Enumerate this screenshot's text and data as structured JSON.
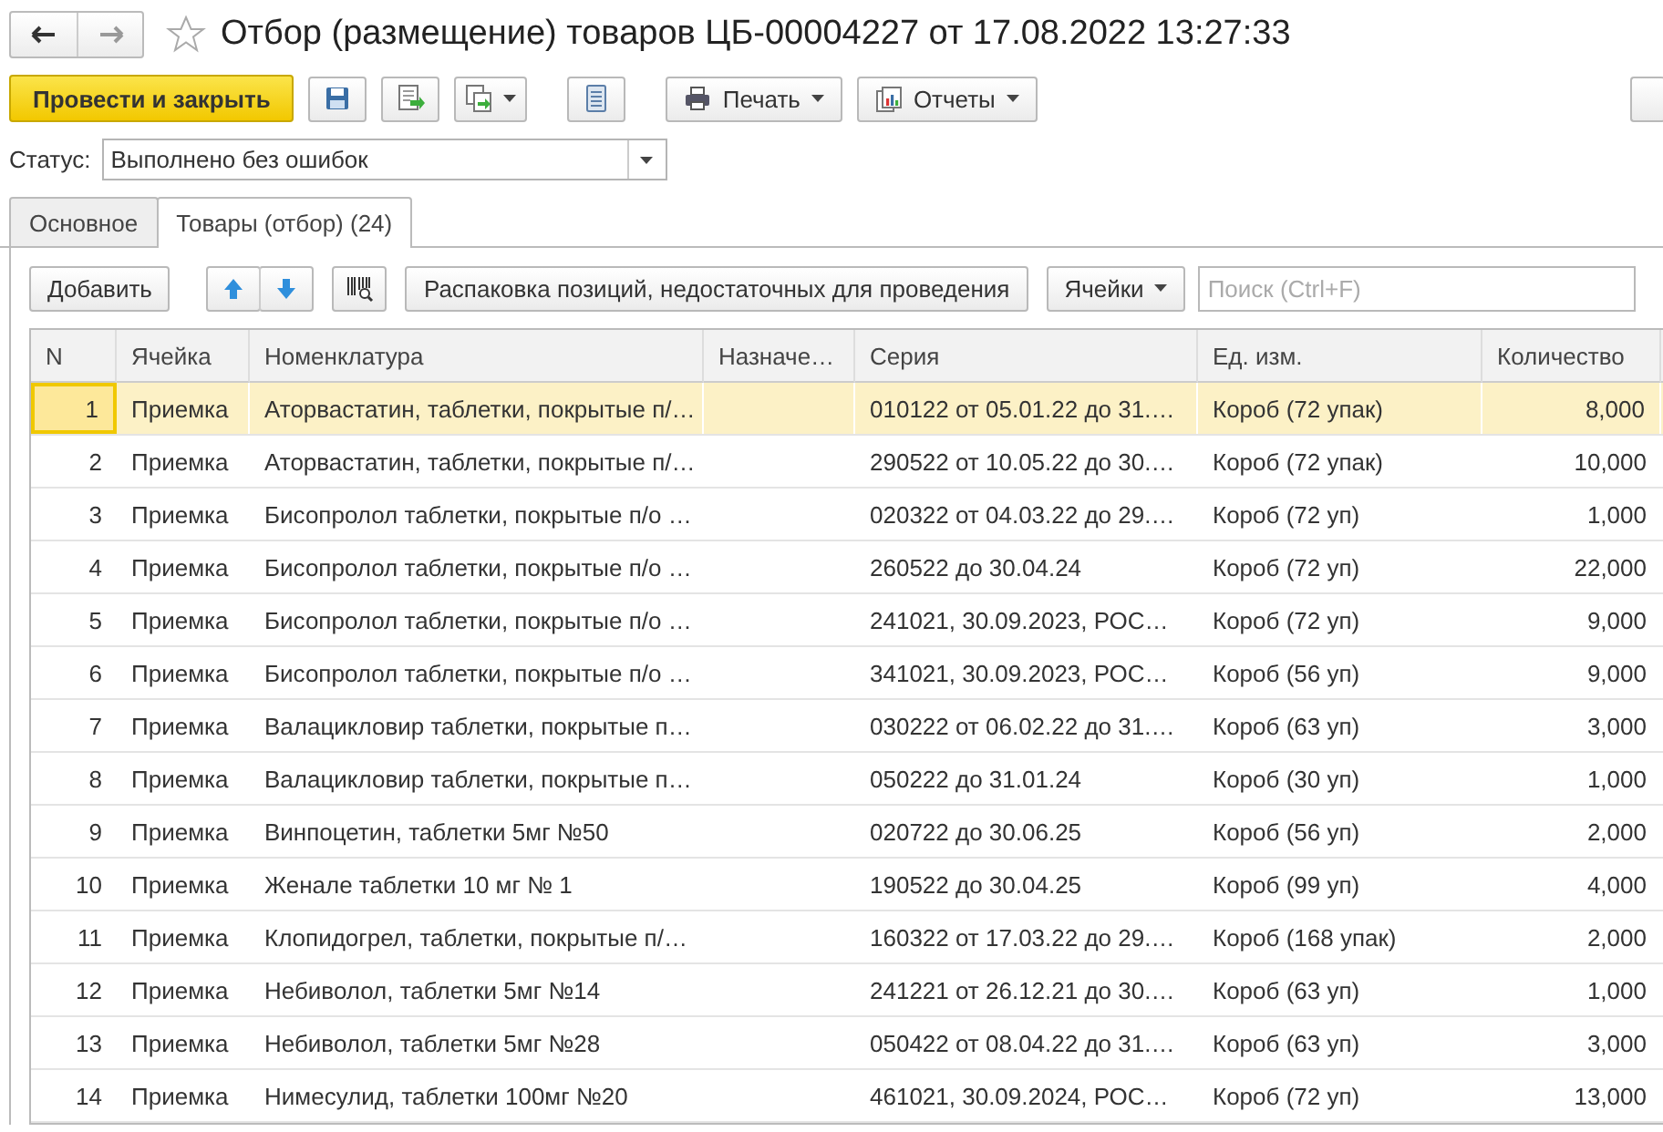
{
  "window": {
    "title": "Отбор (размещение) товаров ЦБ-00004227 от 17.08.2022 13:27:33",
    "favorite": false
  },
  "toolbar": {
    "primary": "Провести и закрыть",
    "print": "Печать",
    "reports": "Отчеты"
  },
  "status": {
    "label": "Статус:",
    "value": "Выполнено без ошибок"
  },
  "tabs": [
    {
      "label": "Основное",
      "selected": false
    },
    {
      "label": "Товары (отбор) (24)",
      "selected": true
    }
  ],
  "table_toolbar": {
    "add": "Добавить",
    "unpack": "Распаковка позиций, недостаточных для проведения",
    "cells": "Ячейки",
    "search_placeholder": "Поиск (Ctrl+F)"
  },
  "table": {
    "columns": [
      "N",
      "Ячейка",
      "Номенклатура",
      "Назначе…",
      "Серия",
      "Ед. изм.",
      "Количество"
    ],
    "rows": [
      {
        "n": "1",
        "cell": "Приемка",
        "item": "Аторвастатин, таблетки, покрытые п/…",
        "series": "010122 от 05.01.22 до 31.…",
        "unit": "Короб (72 упак)",
        "qty": "8,000",
        "selected": true
      },
      {
        "n": "2",
        "cell": "Приемка",
        "item": "Аторвастатин, таблетки, покрытые п/…",
        "series": "290522 от 10.05.22 до 30.…",
        "unit": "Короб (72 упак)",
        "qty": "10,000",
        "selected": false
      },
      {
        "n": "3",
        "cell": "Приемка",
        "item": "Бисопролол таблетки, покрытые п/о …",
        "series": "020322 от 04.03.22 до 29.…",
        "unit": "Короб (72 уп)",
        "qty": "1,000",
        "selected": false
      },
      {
        "n": "4",
        "cell": "Приемка",
        "item": "Бисопролол таблетки, покрытые п/о …",
        "series": "260522 до 30.04.24",
        "unit": "Короб (72 уп)",
        "qty": "22,000",
        "selected": false
      },
      {
        "n": "5",
        "cell": "Приемка",
        "item": "Бисопролол таблетки, покрытые п/о …",
        "series": "241021, 30.09.2023, РОС…",
        "unit": "Короб (72 уп)",
        "qty": "9,000",
        "selected": false
      },
      {
        "n": "6",
        "cell": "Приемка",
        "item": "Бисопролол таблетки, покрытые п/о …",
        "series": "341021, 30.09.2023, РОС…",
        "unit": "Короб (56 уп)",
        "qty": "9,000",
        "selected": false
      },
      {
        "n": "7",
        "cell": "Приемка",
        "item": "Валацикловир таблетки, покрытые п…",
        "series": "030222 от 06.02.22 до 31.…",
        "unit": "Короб (63 уп)",
        "qty": "3,000",
        "selected": false
      },
      {
        "n": "8",
        "cell": "Приемка",
        "item": "Валацикловир таблетки, покрытые п…",
        "series": "050222 до 31.01.24",
        "unit": "Короб (30 уп)",
        "qty": "1,000",
        "selected": false
      },
      {
        "n": "9",
        "cell": "Приемка",
        "item": "Винпоцетин, таблетки 5мг №50",
        "series": "020722 до 30.06.25",
        "unit": "Короб (56 уп)",
        "qty": "2,000",
        "selected": false
      },
      {
        "n": "10",
        "cell": "Приемка",
        "item": "Женале таблетки 10 мг № 1",
        "series": "190522 до 30.04.25",
        "unit": "Короб (99 уп)",
        "qty": "4,000",
        "selected": false
      },
      {
        "n": "11",
        "cell": "Приемка",
        "item": "Клопидогрел, таблетки, покрытые п/…",
        "series": "160322 от 17.03.22 до 29.…",
        "unit": "Короб (168 упак)",
        "qty": "2,000",
        "selected": false
      },
      {
        "n": "12",
        "cell": "Приемка",
        "item": "Небиволол, таблетки 5мг №14",
        "series": "241221 от 26.12.21 до 30.…",
        "unit": "Короб (63 уп)",
        "qty": "1,000",
        "selected": false
      },
      {
        "n": "13",
        "cell": "Приемка",
        "item": "Небиволол, таблетки 5мг №28",
        "series": "050422 от 08.04.22 до 31.…",
        "unit": "Короб (63 уп)",
        "qty": "3,000",
        "selected": false
      },
      {
        "n": "14",
        "cell": "Приемка",
        "item": "Нимесулид, таблетки 100мг №20",
        "series": "461021, 30.09.2024, РОС…",
        "unit": "Короб (72 уп)",
        "qty": "13,000",
        "selected": false
      }
    ]
  }
}
